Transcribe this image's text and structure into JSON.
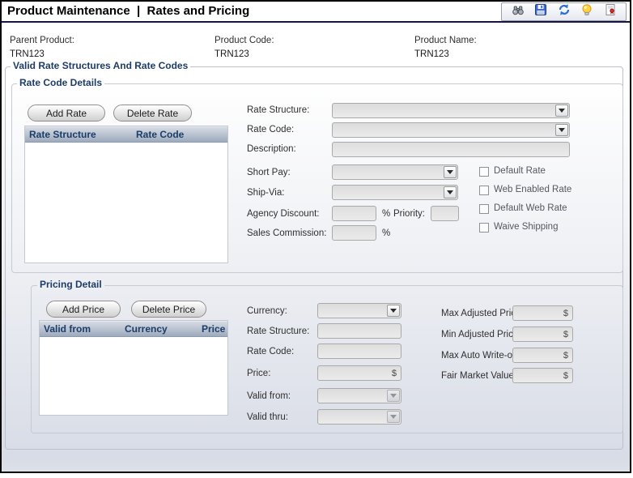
{
  "title": "Product Maintenance  |  Rates and Pricing",
  "toolbar": {
    "icons": [
      "binoculars-find",
      "save",
      "refresh",
      "hint-bulb",
      "report"
    ]
  },
  "header_fields": {
    "parent_product": {
      "label": "Parent Product:",
      "value": "TRN123"
    },
    "product_code": {
      "label": "Product Code:",
      "value": "TRN123"
    },
    "product_name": {
      "label": "Product Name:",
      "value": "TRN123"
    }
  },
  "valid_rates_group_legend": "Valid Rate Structures And Rate Codes",
  "rate_code_details": {
    "legend": "Rate Code Details",
    "add_button": "Add Rate",
    "delete_button": "Delete Rate",
    "table": {
      "headers": [
        "Rate Structure",
        "Rate Code"
      ],
      "rows": []
    },
    "labels": {
      "rate_structure": "Rate Structure:",
      "rate_code": "Rate Code:",
      "description": "Description:",
      "short_pay": "Short Pay:",
      "ship_via": "Ship-Via:",
      "agency_discount": "Agency Discount:",
      "priority": "Priority:",
      "sales_commission": "Sales Commission:"
    },
    "percent_symbol": "%",
    "fields": {
      "rate_structure": "",
      "rate_code": "",
      "description": "",
      "short_pay": "",
      "ship_via": "",
      "agency_discount": "",
      "priority": "",
      "sales_commission": ""
    },
    "checkboxes": [
      {
        "label": "Default Rate",
        "checked": false
      },
      {
        "label": "Web Enabled Rate",
        "checked": false
      },
      {
        "label": "Default Web Rate",
        "checked": false
      },
      {
        "label": "Waive Shipping",
        "checked": false
      }
    ]
  },
  "pricing_detail": {
    "legend": "Pricing Detail",
    "add_button": "Add Price",
    "delete_button": "Delete Price",
    "table": {
      "headers": [
        "Valid from",
        "Currency",
        "Price"
      ],
      "rows": []
    },
    "labels": {
      "currency": "Currency:",
      "rate_structure": "Rate Structure:",
      "rate_code": "Rate Code:",
      "price": "Price:",
      "valid_from": "Valid from:",
      "valid_thru": "Valid thru:",
      "max_adjusted_price": "Max Adjusted Price:",
      "min_adjusted_price": "Min Adjusted Price",
      "max_auto_writeoff": "Max Auto Write-off:",
      "fair_market_value": "Fair Market Value:"
    },
    "currency_symbol": "$",
    "fields": {
      "currency": "",
      "rate_structure": "",
      "rate_code": "",
      "price": "",
      "valid_from": "",
      "valid_thru": "",
      "max_adjusted_price": "",
      "min_adjusted_price": "",
      "max_auto_writeoff": "",
      "fair_market_value": ""
    }
  },
  "colors": {
    "legend_navy": "#1d3c68",
    "table_header_top": "#d9dee6",
    "table_header_bottom": "#9daabd",
    "title_underline": "#16163c",
    "window_border": "#010101",
    "content_bottom": "#d8dce6"
  }
}
